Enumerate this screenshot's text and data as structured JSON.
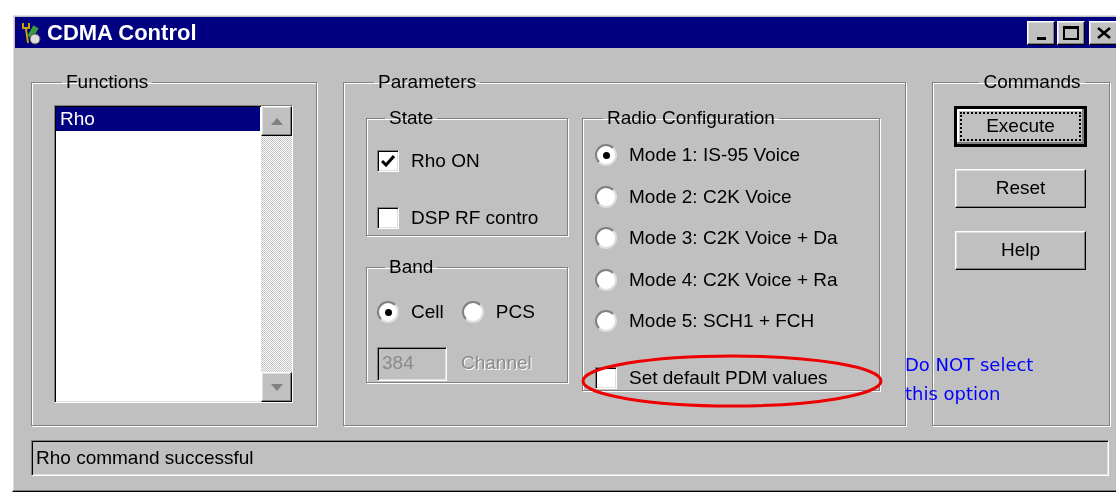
{
  "window": {
    "title": "CDMA Control"
  },
  "functions": {
    "title": "Functions",
    "items": [
      {
        "label": "Rho",
        "selected": true
      }
    ]
  },
  "parameters": {
    "title": "Parameters",
    "state": {
      "title": "State",
      "options": [
        {
          "label": "Rho ON",
          "checked": true
        },
        {
          "label": "DSP RF contro",
          "checked": false
        }
      ]
    },
    "band": {
      "title": "Band",
      "options": [
        {
          "label": "Cell",
          "selected": true
        },
        {
          "label": "PCS",
          "selected": false
        }
      ],
      "channel": {
        "value": "384",
        "label": "Channel",
        "disabled": true
      }
    },
    "radio_configuration": {
      "title": "Radio Configuration",
      "modes": [
        {
          "label": "Mode 1: IS-95 Voice",
          "selected": true
        },
        {
          "label": "Mode 2: C2K Voice",
          "selected": false
        },
        {
          "label": "Mode 3: C2K Voice + Da",
          "selected": false
        },
        {
          "label": "Mode 4: C2K Voice + Ra",
          "selected": false
        },
        {
          "label": "Mode 5: SCH1 + FCH",
          "selected": false
        }
      ],
      "default_pdm": {
        "label": "Set default PDM values",
        "checked": false
      }
    }
  },
  "commands": {
    "title": "Commands",
    "buttons": [
      {
        "label": "Execute",
        "focused": true
      },
      {
        "label": "Reset",
        "focused": false
      },
      {
        "label": "Help",
        "focused": false
      }
    ]
  },
  "status_bar": {
    "text": "Rho command successful"
  },
  "annotation": {
    "text": "Do NOT select this option"
  }
}
